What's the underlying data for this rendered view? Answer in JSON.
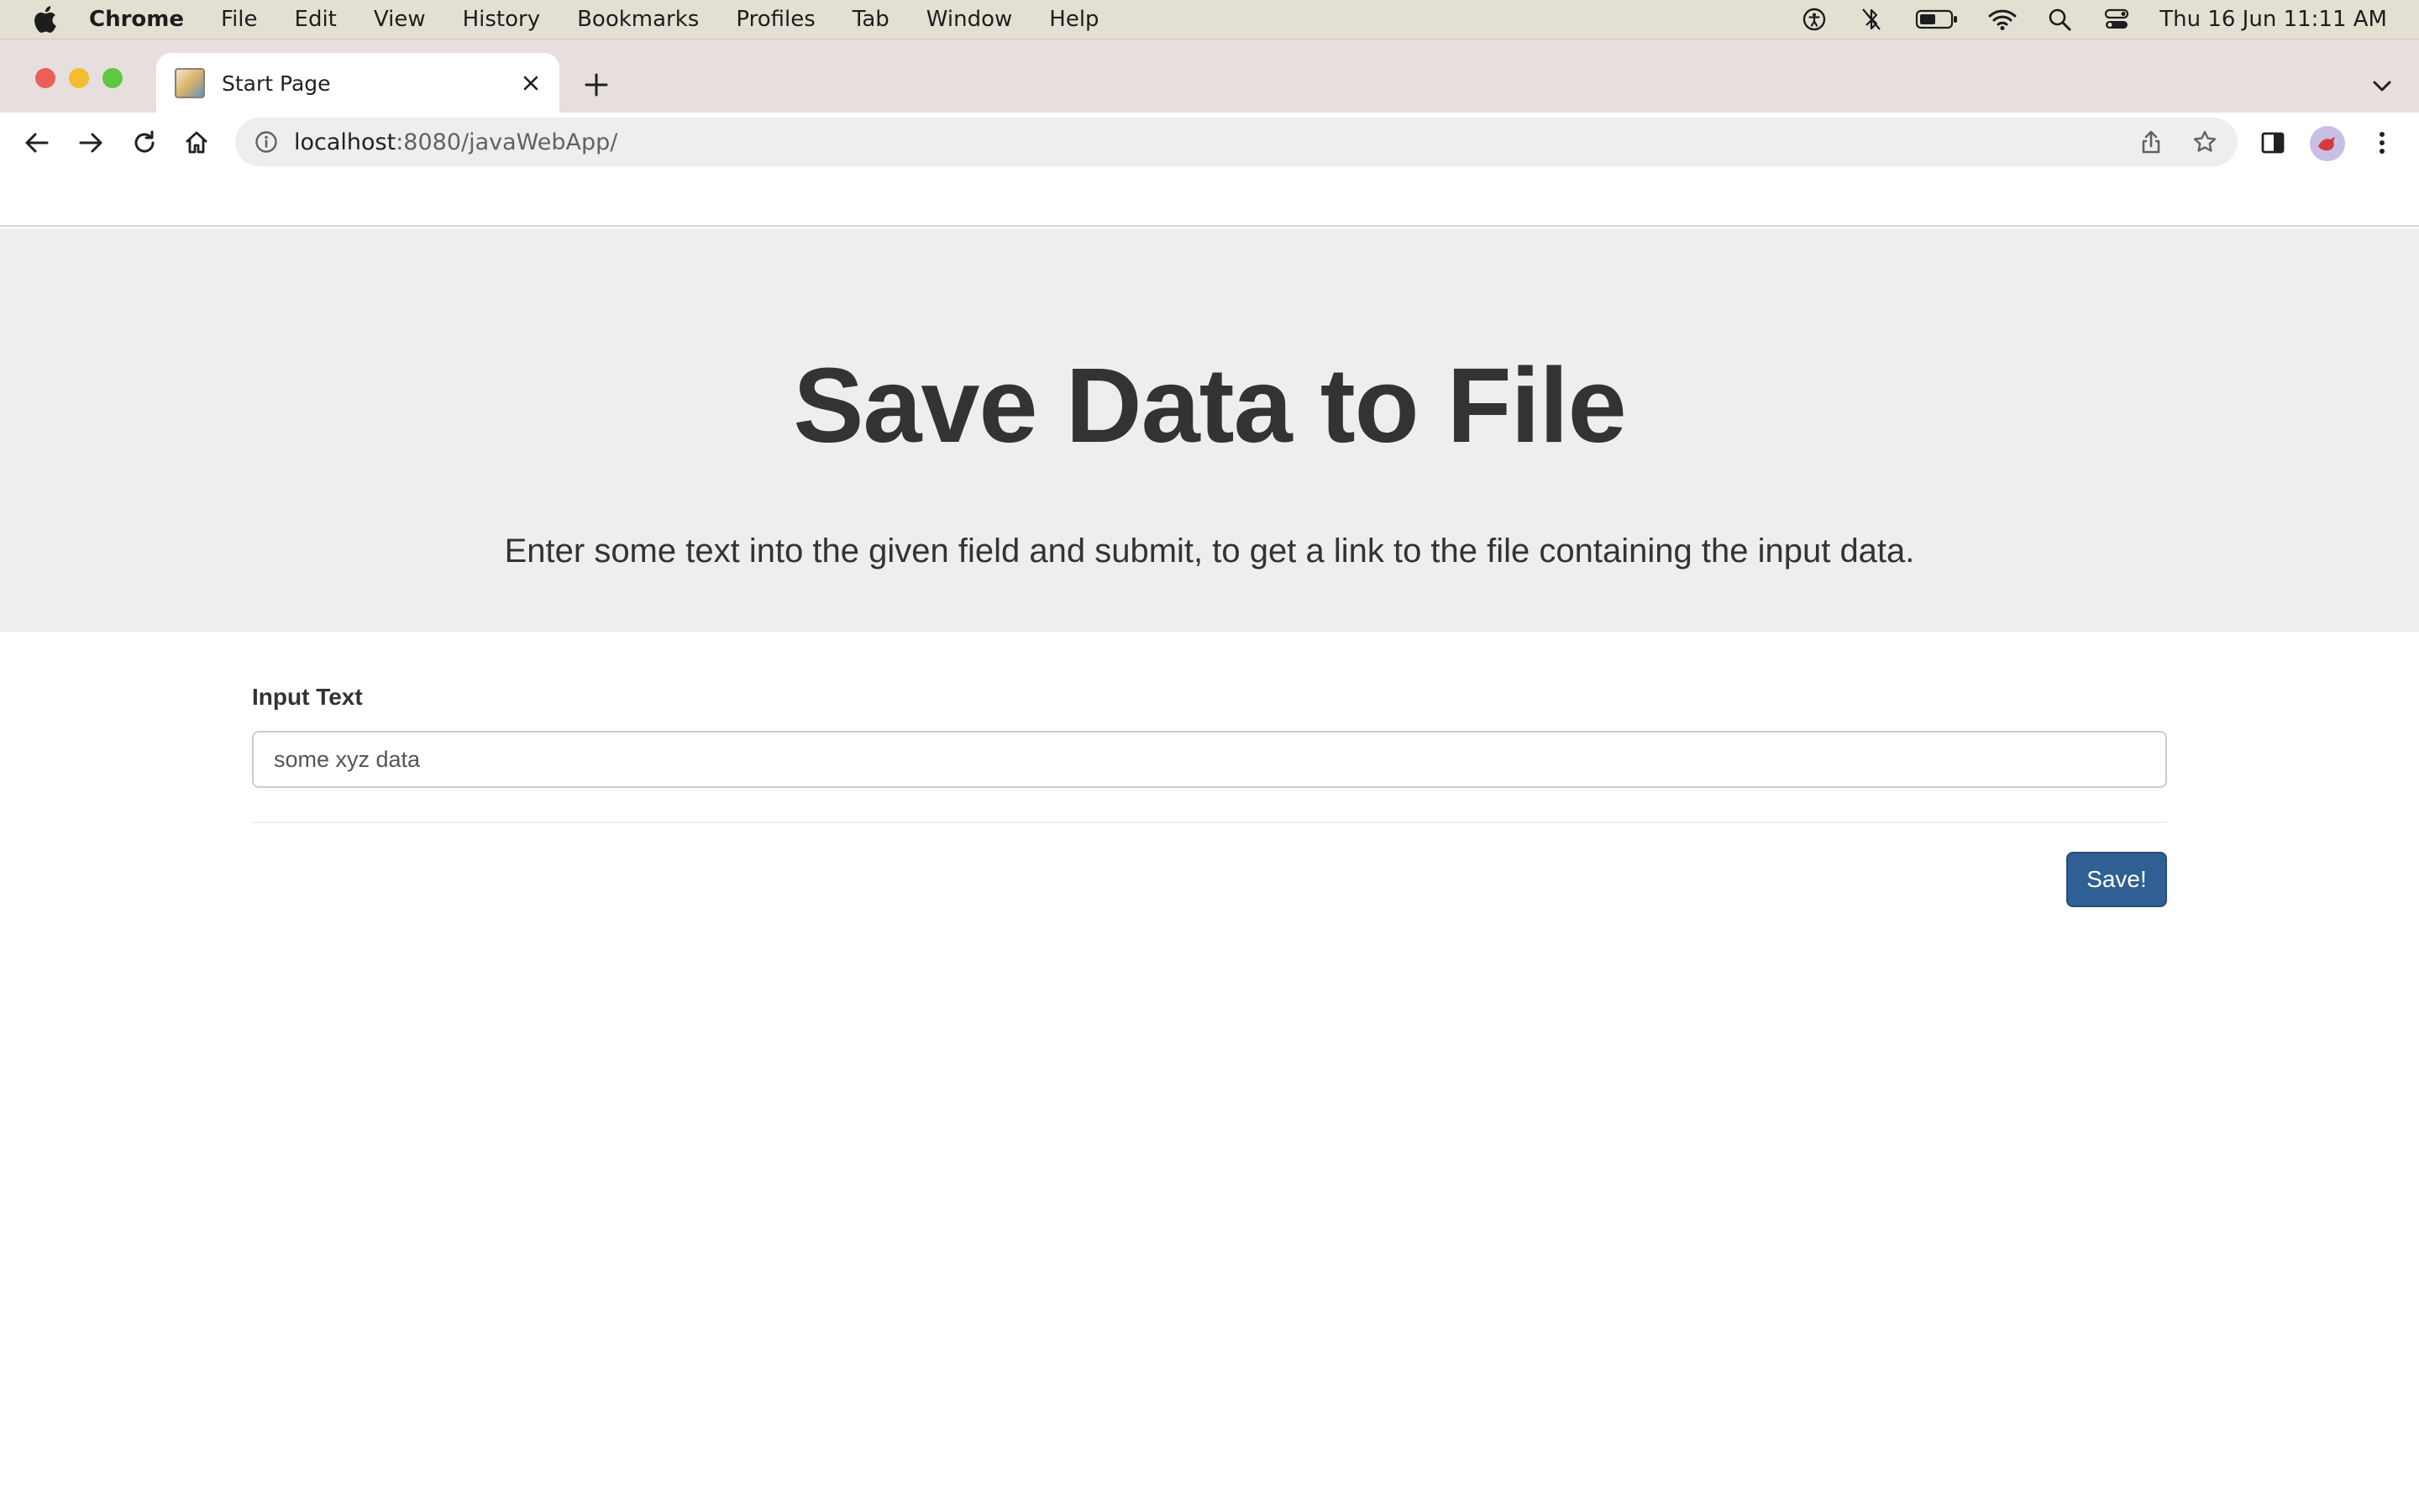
{
  "menubar": {
    "apple_icon": "apple-logo-icon",
    "items": [
      "Chrome",
      "File",
      "Edit",
      "View",
      "History",
      "Bookmarks",
      "Profiles",
      "Tab",
      "Window",
      "Help"
    ],
    "clock": "Thu 16 Jun  11:11 AM",
    "status_icons": [
      "accessibility-icon",
      "bluetooth-off-icon",
      "battery-icon",
      "wifi-icon",
      "spotlight-search-icon",
      "control-center-icon"
    ]
  },
  "tabs": [
    {
      "title": "Start Page",
      "favicon": "page-favicon-icon"
    }
  ],
  "toolbar": {
    "url_host": "localhost",
    "url_rest": ":8080/javaWebApp/"
  },
  "page": {
    "title": "Save Data to File",
    "subtitle": "Enter some text into the given field and submit, to get a link to the file containing the input data.",
    "form": {
      "label": "Input Text",
      "input_value": "some xyz data",
      "submit_label": "Save!"
    }
  },
  "colors": {
    "menubar_bg": "#e3e0d3",
    "tabstrip_bg": "#e7dfdd",
    "jumbotron_bg": "#eeeeee",
    "button_bg": "#2f5f93",
    "text": "#333333"
  }
}
